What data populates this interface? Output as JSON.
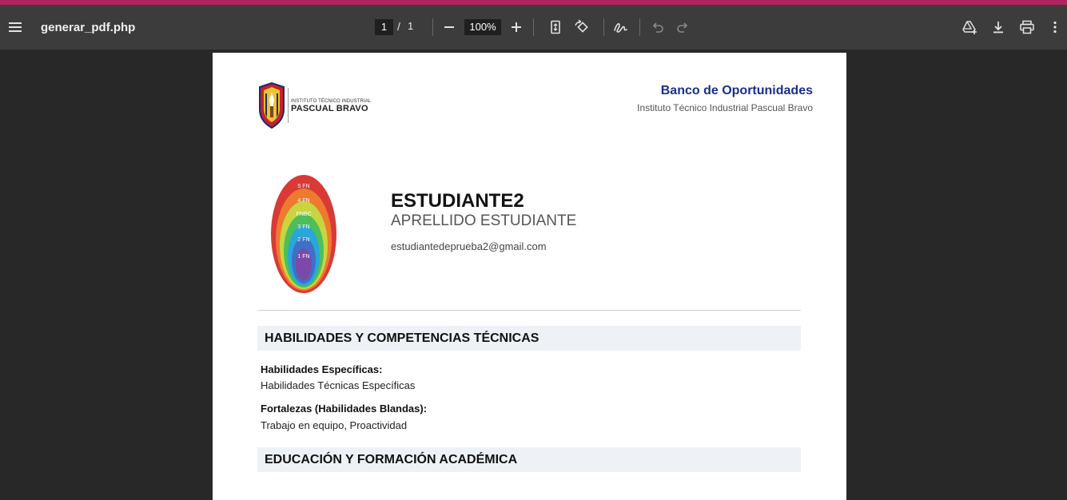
{
  "toolbar": {
    "filename": "generar_pdf.php",
    "current_page": "1",
    "page_separator": "/",
    "total_pages": "1",
    "zoom": "100%",
    "icons": [
      "menu-icon",
      "zoom-out-icon",
      "zoom-in-icon",
      "fit-page-icon",
      "rotate-icon",
      "annotate-icon",
      "undo-icon",
      "redo-icon",
      "drive-icon",
      "download-icon",
      "print-icon",
      "more-icon"
    ]
  },
  "document": {
    "logo": {
      "line1": "INSTITUTO TÉCNICO INDUSTRIAL",
      "line2": "PASCUAL BRAVO"
    },
    "header": {
      "title": "Banco de Oportunidades",
      "subtitle": "Instituto Técnico Industrial Pascual Bravo"
    },
    "avatar_rings": [
      "5 FN",
      "4 FN",
      "FNBC",
      "3 FN",
      "2 FN",
      "1 FN"
    ],
    "student": {
      "name": "ESTUDIANTE2",
      "last_name": "APRELLIDO ESTUDIANTE",
      "email": "estudiantedeprueba2@gmail.com"
    },
    "sections": [
      {
        "title": "HABILIDADES Y COMPETENCIAS TÉCNICAS",
        "fields": [
          {
            "label": "Habilidades Específicas:",
            "value": "Habilidades Técnicas Específicas"
          },
          {
            "label": "Fortalezas (Habilidades Blandas):",
            "value": "Trabajo en equipo, Proactividad"
          }
        ]
      },
      {
        "title": "EDUCACIÓN Y FORMACIÓN ACADÉMICA"
      }
    ]
  },
  "colors": {
    "accent_strip": "#b3235f",
    "toolbar_bg": "#3c3c3c",
    "viewer_bg": "#282828",
    "bank_title": "#1a2f8a"
  }
}
